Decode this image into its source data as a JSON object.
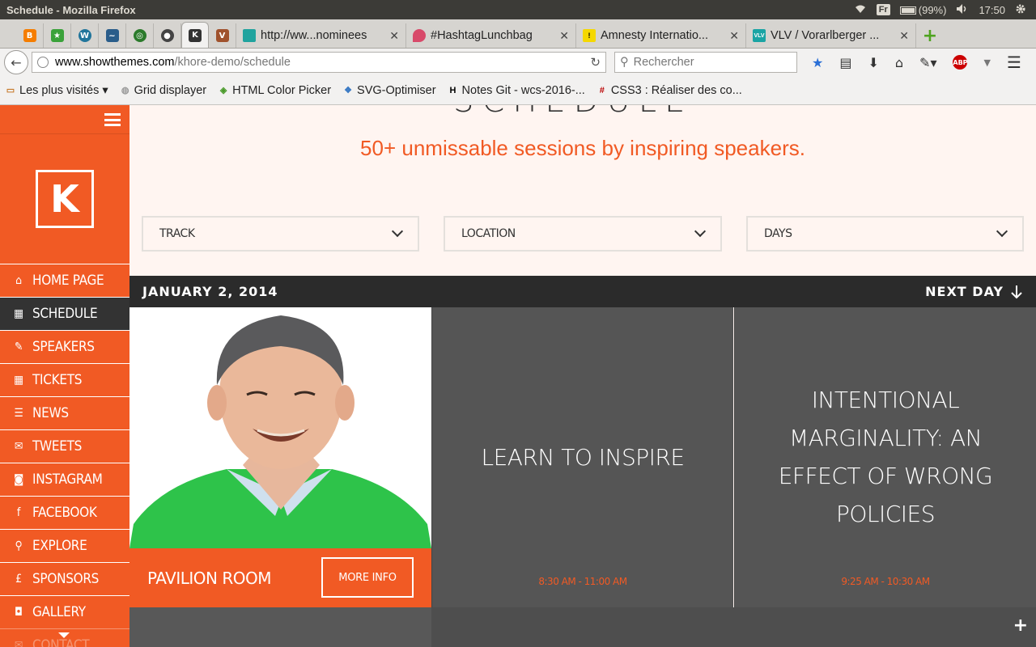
{
  "os": {
    "window_title": "Schedule - Mozilla Firefox",
    "keyboard_layout": "Fr",
    "battery": "(99%)",
    "time": "17:50"
  },
  "tabs": {
    "pinned": [
      {
        "icon": "blogger-icon",
        "color": "#f57d00"
      },
      {
        "icon": "star-icon",
        "color": "#3aa23a"
      },
      {
        "icon": "wordpress-icon",
        "color": "#21759b"
      },
      {
        "icon": "wave-icon",
        "color": "#2a5d8a"
      },
      {
        "icon": "circle-icon",
        "color": "#2b7a2b"
      },
      {
        "icon": "github-icon",
        "color": "#444"
      },
      {
        "icon": "k-logo-icon",
        "color": "#333",
        "active": true
      },
      {
        "icon": "v-icon",
        "color": "#a0522d"
      }
    ],
    "items": [
      {
        "label": "http://ww...nominees",
        "icon_color": "#20a39e"
      },
      {
        "label": "#HashtagLunchbag",
        "icon_color": "#d84a6a"
      },
      {
        "label": "Amnesty Internatio...",
        "icon_color": "#f5d800"
      },
      {
        "label": "VLV / Vorarlberger ...",
        "icon_color": "#1aa4a4"
      }
    ],
    "new_tab": "+"
  },
  "nav": {
    "url_host": "www.showthemes.com",
    "url_path": "/khore-demo/schedule",
    "search_placeholder": "Rechercher"
  },
  "bookmarks": [
    {
      "label": "Les plus visités ▾",
      "icon": "folder-icon"
    },
    {
      "label": "Grid displayer",
      "icon": "globe-icon"
    },
    {
      "label": "HTML Color Picker",
      "icon": "color-picker-icon"
    },
    {
      "label": "SVG-Optimiser",
      "icon": "svg-icon"
    },
    {
      "label": "Notes Git - wcs-2016-...",
      "icon": "h-icon"
    },
    {
      "label": "CSS3 : Réaliser des co...",
      "icon": "hash-icon"
    }
  ],
  "sidebar": {
    "logo": "K",
    "items": [
      {
        "label": "HOME PAGE",
        "icon": "⌂"
      },
      {
        "label": "SCHEDULE",
        "icon": "▦",
        "active": true
      },
      {
        "label": "SPEAKERS",
        "icon": "✎"
      },
      {
        "label": "TICKETS",
        "icon": "▦"
      },
      {
        "label": "NEWS",
        "icon": "☰"
      },
      {
        "label": "TWEETS",
        "icon": "✉"
      },
      {
        "label": "INSTAGRAM",
        "icon": "◙"
      },
      {
        "label": "FACEBOOK",
        "icon": "f"
      },
      {
        "label": "EXPLORE",
        "icon": "⚲"
      },
      {
        "label": "SPONSORS",
        "icon": "£"
      },
      {
        "label": "GALLERY",
        "icon": "◘"
      },
      {
        "label": "CONTACT",
        "icon": "✉"
      }
    ]
  },
  "main": {
    "heading": "SCHEDULE",
    "tagline": "50+ unmissable sessions by inspiring speakers.",
    "filters": [
      {
        "label": "TRACK"
      },
      {
        "label": "LOCATION"
      },
      {
        "label": "DAYS"
      }
    ],
    "day": "JANUARY 2, 2014",
    "next_day": "NEXT DAY",
    "card": {
      "room": "PAVILION ROOM",
      "more_info": "MORE INFO"
    },
    "sessions": [
      {
        "title": "LEARN TO INSPIRE",
        "time": "8:30 AM - 11:00 AM"
      },
      {
        "title": "INTENTIONAL MARGINALITY: AN EFFECT OF WRONG POLICIES",
        "time": "9:25 AM - 10:30 AM"
      }
    ]
  },
  "colors": {
    "brand": "#f15a24",
    "dark": "#2b2b2b",
    "session_bg": "#555555",
    "page_bg": "#fff5f1"
  }
}
